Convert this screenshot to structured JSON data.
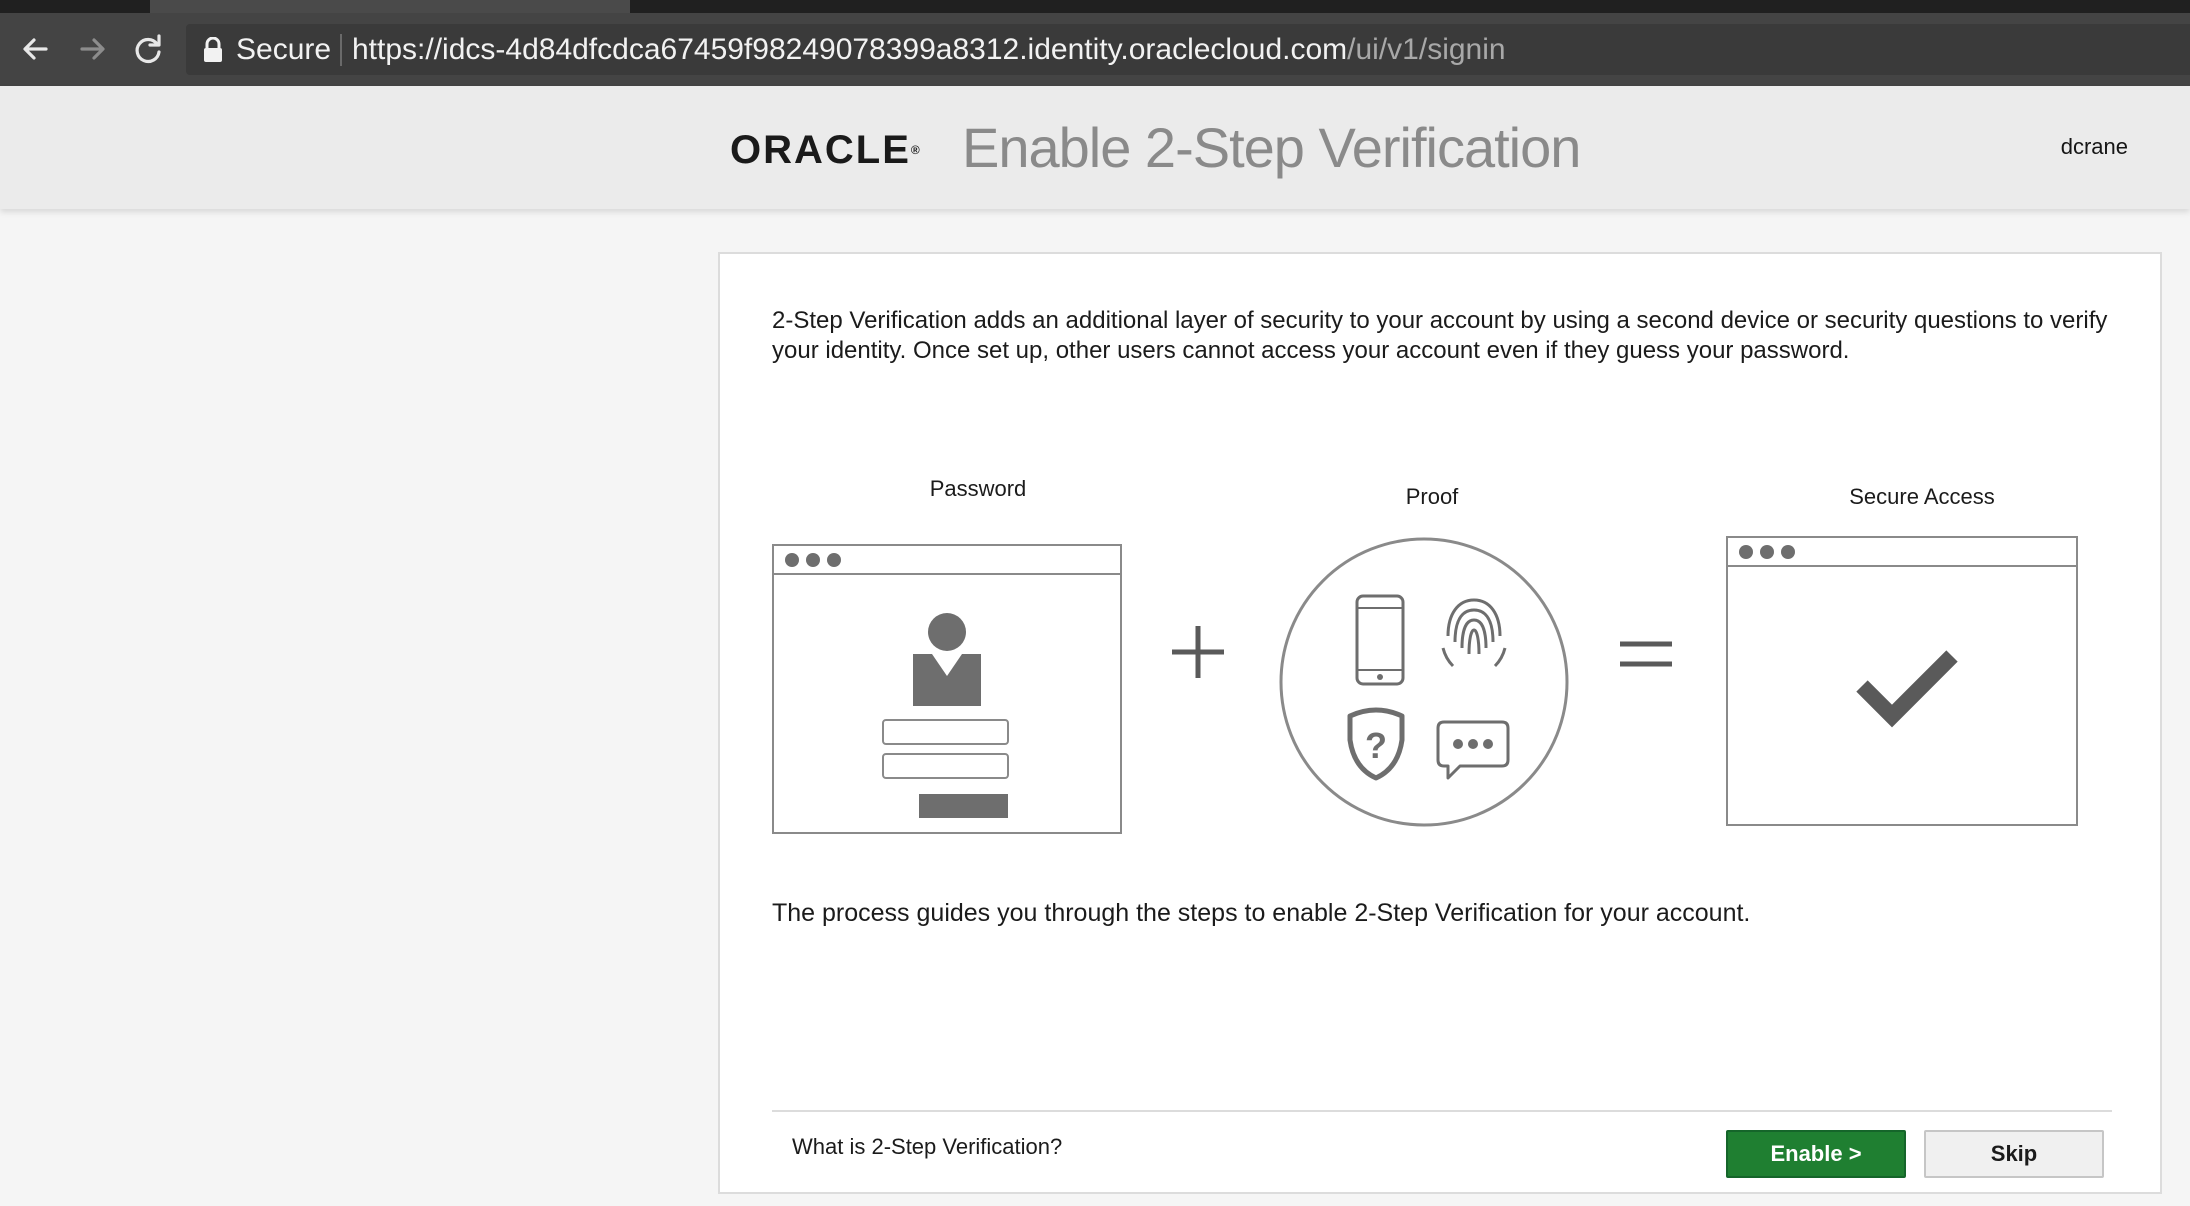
{
  "browser": {
    "secure_label": "Secure",
    "url_host": "https://idcs-4d84dfcdca67459f98249078399a8312.identity.oraclecloud.com",
    "url_path": "/ui/v1/signin"
  },
  "header": {
    "logo_text": "ORACLE",
    "logo_mark": "®",
    "title": "Enable 2-Step Verification",
    "username": "dcrane"
  },
  "content": {
    "intro": "2-Step Verification adds an additional layer of security to your account by using a second device or security questions to verify your identity. Once set up, other users cannot access your account even if they guess your password.",
    "steps": {
      "password": "Password",
      "proof": "Proof",
      "secure_access": "Secure Access"
    },
    "process": "The process guides you through the steps to enable 2-Step Verification for your account."
  },
  "footer": {
    "help_link": "What is 2-Step Verification?",
    "enable_label": "Enable >",
    "skip_label": "Skip"
  },
  "icons": [
    "back-arrow-icon",
    "forward-arrow-icon",
    "reload-icon",
    "lock-icon",
    "user-icon",
    "phone-icon",
    "fingerprint-icon",
    "shield-question-icon",
    "chat-icon",
    "checkmark-icon"
  ],
  "colors": {
    "enable_button": "#1f7f31",
    "header_bg": "#ebebeb",
    "title": "#8a8a8a"
  }
}
